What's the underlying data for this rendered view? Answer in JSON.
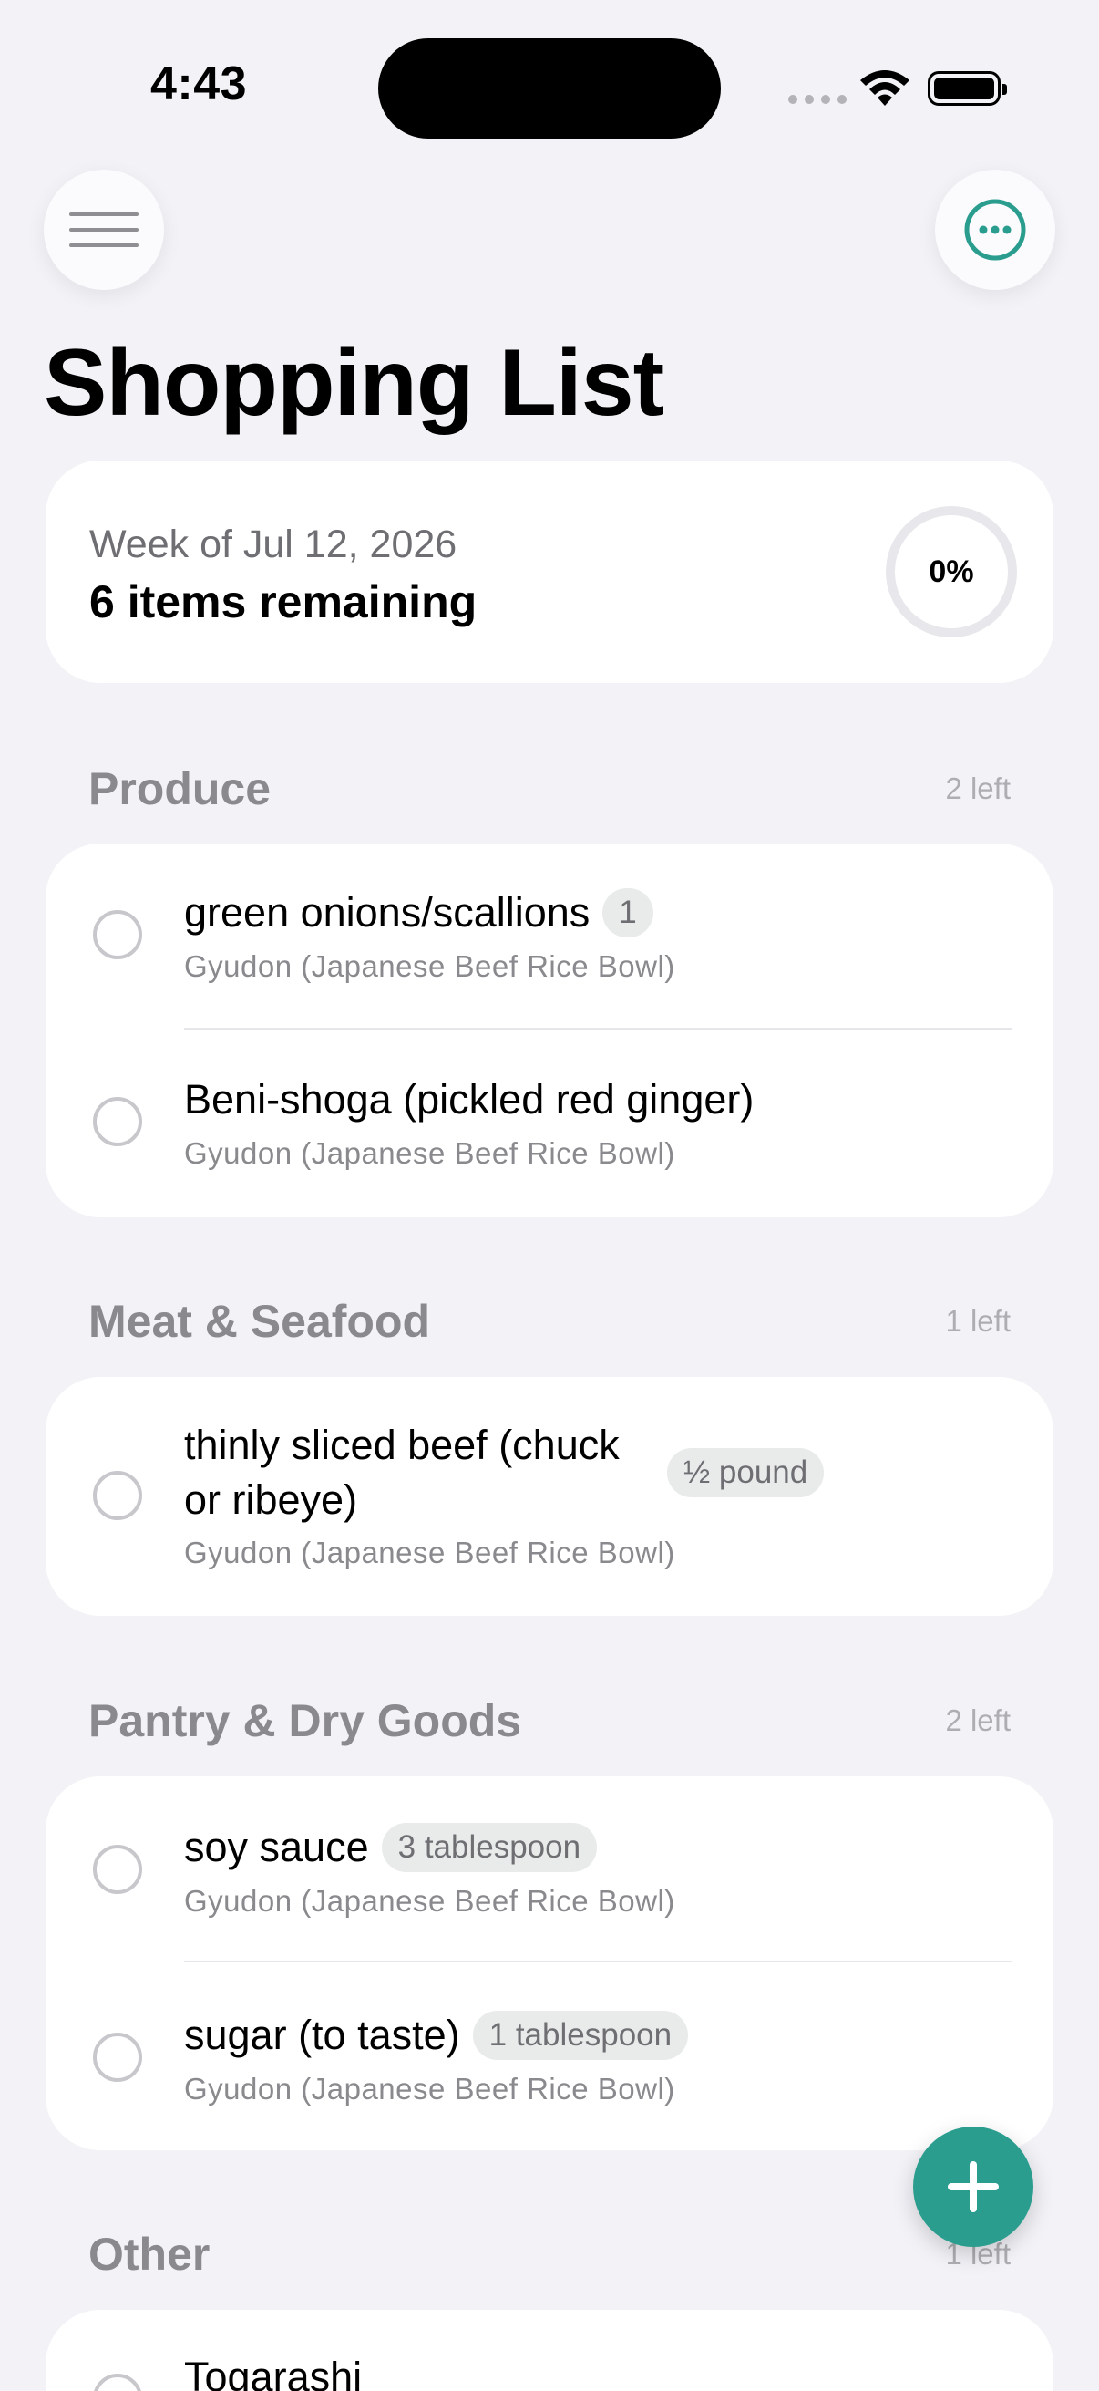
{
  "status_bar": {
    "time": "4:43"
  },
  "header": {
    "title": "Shopping List",
    "menu_icon": "hamburger-icon",
    "more_icon": "ellipsis-circle-icon"
  },
  "summary": {
    "week": "Week of Jul 12, 2026",
    "remaining": "6 items remaining",
    "progress_label": "0%",
    "progress": 0
  },
  "colors": {
    "accent": "#2a9d8f",
    "background": "#f2f2f7"
  },
  "sections": [
    {
      "title": "Produce",
      "count": "2 left",
      "items": [
        {
          "name": "green onions/scallions",
          "qty": "1",
          "recipe": "Gyudon (Japanese Beef Rice Bowl)"
        },
        {
          "name": "Beni-shoga (pickled red ginger)",
          "recipe": "Gyudon (Japanese Beef Rice Bowl)"
        }
      ]
    },
    {
      "title": "Meat & Seafood",
      "count": "1 left",
      "items": [
        {
          "name_line1": "thinly sliced beef (chuck",
          "name_line2": "or ribeye)",
          "qty": "½ pound",
          "recipe": "Gyudon (Japanese Beef Rice Bowl)"
        }
      ]
    },
    {
      "title": "Pantry & Dry Goods",
      "count": "2 left",
      "items": [
        {
          "name": "soy sauce",
          "qty": "3 tablespoon",
          "recipe": "Gyudon (Japanese Beef Rice Bowl)"
        },
        {
          "name": "sugar (to taste)",
          "qty": "1 tablespoon",
          "recipe": "Gyudon (Japanese Beef Rice Bowl)"
        }
      ]
    },
    {
      "title": "Other",
      "count": "1 left",
      "items": [
        {
          "name": "Togarashi"
        }
      ]
    }
  ]
}
